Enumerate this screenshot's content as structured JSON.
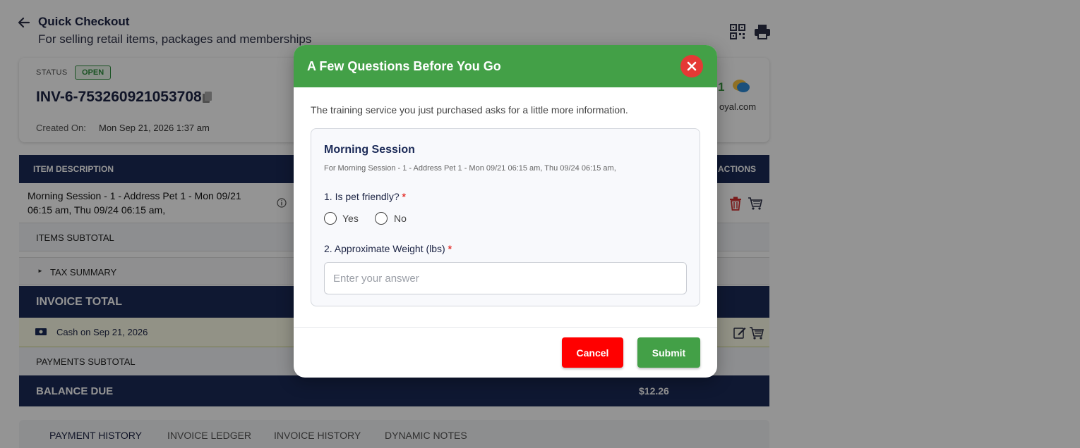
{
  "page": {
    "title": "Quick Checkout",
    "subtitle": "For selling retail items, packages and memberships"
  },
  "invoice": {
    "status_label": "STATUS",
    "status": "OPEN",
    "number": "INV-6-753260921053708",
    "created_label": "Created On:",
    "created_value": "Mon Sep 21, 2026 1:37 am",
    "count": "1",
    "email_fragment": "oyal.com"
  },
  "table": {
    "col_description": "ITEM DESCRIPTION",
    "col_actions": "ACTIONS",
    "item": "Morning Session - 1 - Address Pet 1 - Mon 09/21 06:15 am, Thu 09/24 06:15 am,",
    "items_subtotal": "ITEMS SUBTOTAL",
    "tax_summary": "TAX SUMMARY",
    "invoice_total": "INVOICE TOTAL",
    "payment": "Cash on Sep 21, 2026",
    "payments_subtotal": "PAYMENTS SUBTOTAL",
    "balance_due_label": "BALANCE DUE",
    "balance_due_value": "$12.26"
  },
  "tabs": [
    {
      "label": "PAYMENT HISTORY",
      "active": true
    },
    {
      "label": "INVOICE LEDGER",
      "active": false
    },
    {
      "label": "INVOICE HISTORY",
      "active": false
    },
    {
      "label": "DYNAMIC NOTES",
      "active": false
    }
  ],
  "modal": {
    "title": "A Few Questions Before You Go",
    "intro": "The training service you just purchased asks for a little more information.",
    "card_title": "Morning Session",
    "card_subtitle": "For Morning Session - 1 - Address Pet 1 - Mon 09/21 06:15 am, Thu 09/24 06:15 am,",
    "question1": "1. Is pet friendly?",
    "required_mark": "*",
    "option_yes": "Yes",
    "option_no": "No",
    "question2": "2. Approximate Weight (lbs)",
    "answer_placeholder": "Enter your answer",
    "cancel_label": "Cancel",
    "submit_label": "Submit"
  },
  "colors": {
    "header_green": "#43a047",
    "close_red": "#e53935",
    "cancel_red": "#ff0000",
    "navy": "#1b2a57"
  },
  "icons": [
    "back-arrow-icon",
    "qr-code-icon",
    "print-icon",
    "copy-icon",
    "chat-icon",
    "info-icon",
    "trash-icon",
    "cart-icon",
    "cash-icon",
    "edit-icon",
    "close-icon"
  ]
}
